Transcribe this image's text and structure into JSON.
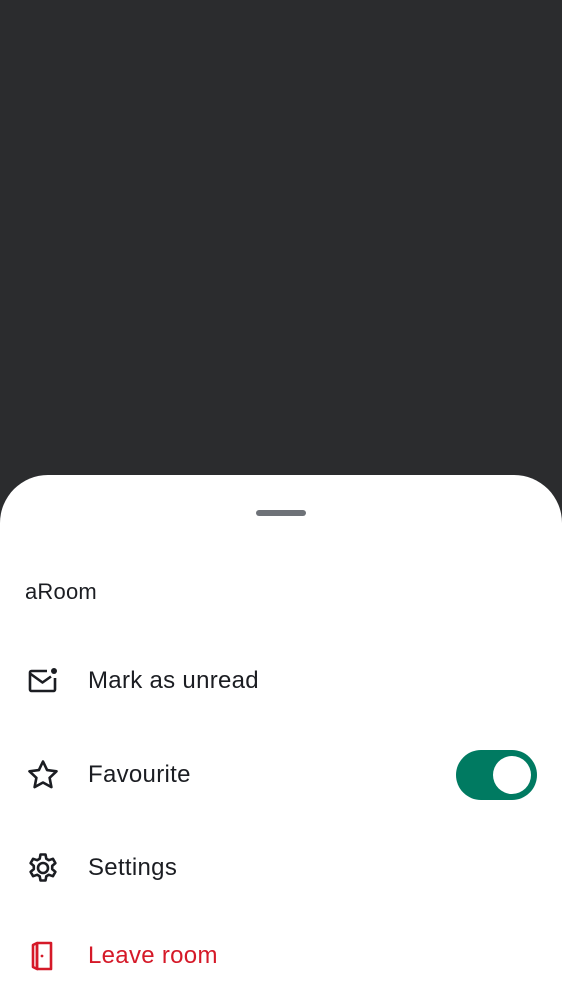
{
  "sheet": {
    "room_name": "aRoom",
    "items": [
      {
        "label": "Mark as unread",
        "icon": "mail-unread-icon"
      },
      {
        "label": "Favourite",
        "icon": "star-icon",
        "toggle_on": true
      },
      {
        "label": "Settings",
        "icon": "gear-icon"
      },
      {
        "label": "Leave room",
        "icon": "leave-door-icon",
        "destructive": true
      }
    ]
  },
  "colors": {
    "backdrop": "#2b2c2e",
    "toggle_on": "#007a61",
    "destructive": "#d51928"
  }
}
